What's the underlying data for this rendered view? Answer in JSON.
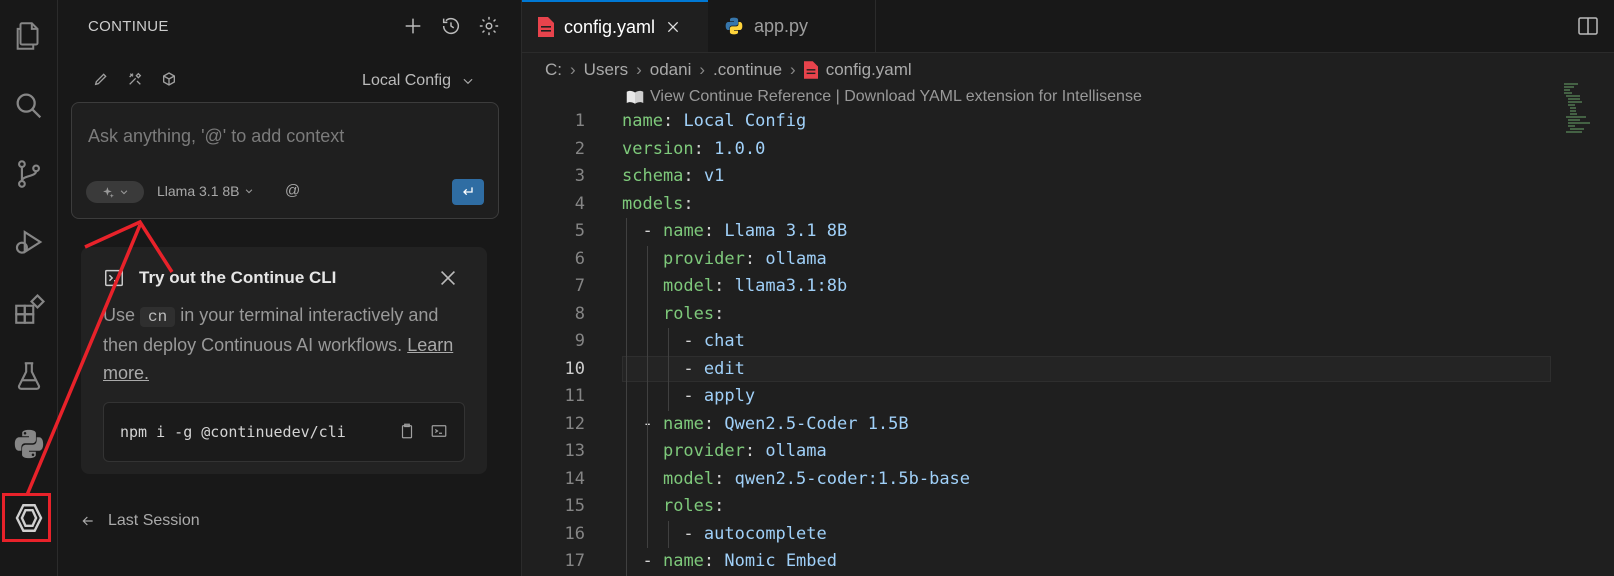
{
  "colors": {
    "accent": "#0078d4",
    "highlight": "#e8222a",
    "send_button": "#2f6da3",
    "yaml_key": "#7ec97b",
    "yaml_value": "#a0d0f8"
  },
  "activity_bar": {
    "items": [
      "explorer-icon",
      "search-icon",
      "source-control-icon",
      "run-debug-icon",
      "extensions-icon",
      "testing-icon",
      "python-icon",
      "continue-icon"
    ]
  },
  "sidebar": {
    "title": "CONTINUE",
    "actions": [
      "plus-icon",
      "history-icon",
      "settings-gear-icon"
    ],
    "tools": [
      "pencil-icon",
      "tools-icon",
      "cube-icon"
    ],
    "config_selector": "Local Config",
    "chat": {
      "placeholder": "Ask anything, '@' to add context",
      "model": "Llama 3.1 8B",
      "at_label": "@"
    },
    "cli_card": {
      "title": "Try out the Continue CLI",
      "text_before": "Use",
      "code": "cn",
      "text_after": "in your terminal interactively and then deploy Continuous AI workflows.",
      "link": "Learn more.",
      "command": "npm i -g @continuedev/cli"
    },
    "last_session": "Last Session"
  },
  "editor": {
    "tabs": [
      {
        "label": "config.yaml",
        "active": true
      },
      {
        "label": "app.py",
        "active": false
      }
    ],
    "breadcrumb": [
      "C:",
      "Users",
      "odani",
      ".continue",
      "config.yaml"
    ],
    "codelens": "View Continue Reference | Download YAML extension for Intellisense",
    "current_line": 10,
    "lines": [
      {
        "n": "1",
        "indent": "",
        "dash": "",
        "key": "name",
        "value": "Local Config"
      },
      {
        "n": "2",
        "indent": "",
        "dash": "",
        "key": "version",
        "value": "1.0.0"
      },
      {
        "n": "3",
        "indent": "",
        "dash": "",
        "key": "schema",
        "value": "v1"
      },
      {
        "n": "4",
        "indent": "",
        "dash": "",
        "key": "models",
        "value": ""
      },
      {
        "n": "5",
        "indent": "  ",
        "dash": "- ",
        "key": "name",
        "value": "Llama 3.1 8B"
      },
      {
        "n": "6",
        "indent": "    ",
        "dash": "",
        "key": "provider",
        "value": "ollama"
      },
      {
        "n": "7",
        "indent": "    ",
        "dash": "",
        "key": "model",
        "value": "llama3.1:8b"
      },
      {
        "n": "8",
        "indent": "    ",
        "dash": "",
        "key": "roles",
        "value": ""
      },
      {
        "n": "9",
        "indent": "      ",
        "dash": "- ",
        "key": "",
        "value": "chat"
      },
      {
        "n": "10",
        "indent": "      ",
        "dash": "- ",
        "key": "",
        "value": "edit"
      },
      {
        "n": "11",
        "indent": "      ",
        "dash": "- ",
        "key": "",
        "value": "apply"
      },
      {
        "n": "12",
        "indent": "  ",
        "dash": "- ",
        "key": "name",
        "value": "Qwen2.5-Coder 1.5B"
      },
      {
        "n": "13",
        "indent": "    ",
        "dash": "",
        "key": "provider",
        "value": "ollama"
      },
      {
        "n": "14",
        "indent": "    ",
        "dash": "",
        "key": "model",
        "value": "qwen2.5-coder:1.5b-base"
      },
      {
        "n": "15",
        "indent": "    ",
        "dash": "",
        "key": "roles",
        "value": ""
      },
      {
        "n": "16",
        "indent": "      ",
        "dash": "- ",
        "key": "",
        "value": "autocomplete"
      },
      {
        "n": "17",
        "indent": "  ",
        "dash": "- ",
        "key": "name",
        "value": "Nomic Embed"
      }
    ]
  }
}
